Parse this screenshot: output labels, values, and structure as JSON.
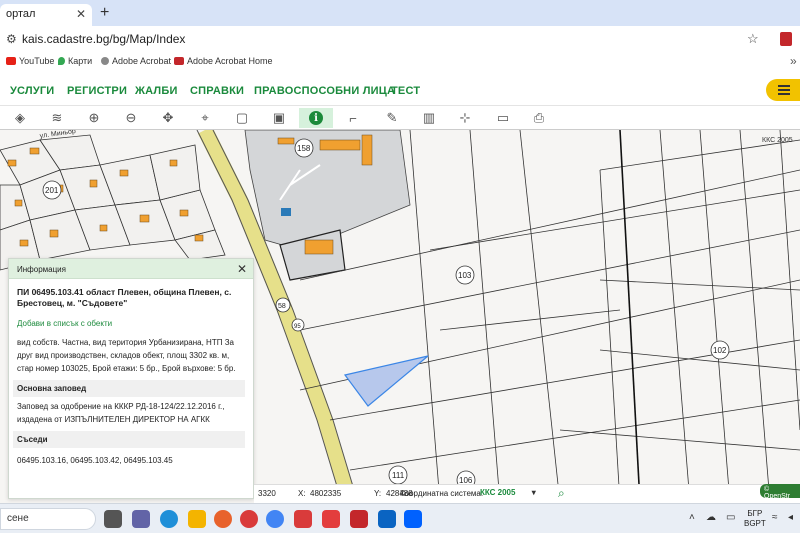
{
  "browser": {
    "tab_title": "ортал",
    "tab_close": "✕",
    "new_tab": "+",
    "url": "kais.cadastre.bg/bg/Map/Index",
    "bookmarks": [
      {
        "label": "YouTube",
        "color": "#e62117"
      },
      {
        "label": "Карти",
        "color": "#34a853"
      },
      {
        "label": "Adobe Acrobat",
        "color": "#888888"
      },
      {
        "label": "Adobe Acrobat Home",
        "color": "#c3272b"
      }
    ]
  },
  "nav": {
    "items": [
      "УСЛУГИ",
      "РЕГИСТРИ",
      "ЖАЛБИ",
      "СПРАВКИ",
      "ПРАВОСПОСОБНИ ЛИЦА",
      "ТЕСТ"
    ],
    "accent": "#1a8a3c",
    "menu_color": "#f2c200"
  },
  "toolbar": {
    "tools": [
      "layers-icon",
      "stack-icon",
      "zoom-in-icon",
      "zoom-out-icon",
      "pan-icon",
      "location-pin-icon",
      "select-rect-icon",
      "select-rect-plus-icon",
      "info-icon",
      "measure-icon",
      "draw-icon",
      "map-icon",
      "split-icon",
      "ruler-icon",
      "print-icon"
    ],
    "active_tool": "info-icon",
    "info_glyph": "i"
  },
  "map": {
    "labels": {
      "parcel_158": "158",
      "parcel_201": "201",
      "parcel_103": "103",
      "parcel_102": "102",
      "parcel_111": "111",
      "parcel_106": "106",
      "road_58": "58",
      "road_95": "95",
      "kks": "ККС 2005",
      "street": "ул. Миньор"
    }
  },
  "info_panel": {
    "header": "Информация",
    "close": "✕",
    "title": "ПИ 06495.103.41 област Плевен, община Плевен, с. Брестовец, м. \"Съдовете\"",
    "add_link": "Добави в списък с обекти",
    "description": "вид собств. Частна, вид територия Урбанизирана, НТП За друг вид производствен, складов обект, площ 3302 кв. м, стар номер 103025, Брой етажи: 5 бр., Брой върхове: 5 бр.",
    "order_heading": "Основна заповед",
    "order_text": "Заповед за одобрение на КККР РД-18-124/22.12.2016 г., издадена от ИЗПЪЛНИТЕЛЕН ДИРЕКТОР НА АГКК",
    "neighbors_heading": "Съседи",
    "neighbors": "06495.103.16, 06495.103.42, 06495.103.45"
  },
  "status": {
    "partial_coord": "3320",
    "x_label": "X:",
    "x_value": "4802335",
    "y_label": "Y:",
    "y_value": "428488",
    "cs_label": "Координатна система:",
    "cs_value": "ККС 2005",
    "cs_arrow": "▾",
    "osm": "© OpenStr"
  },
  "taskbar": {
    "search_text": "сене",
    "lang_top": "БГР",
    "lang_bottom": "BGPT"
  }
}
